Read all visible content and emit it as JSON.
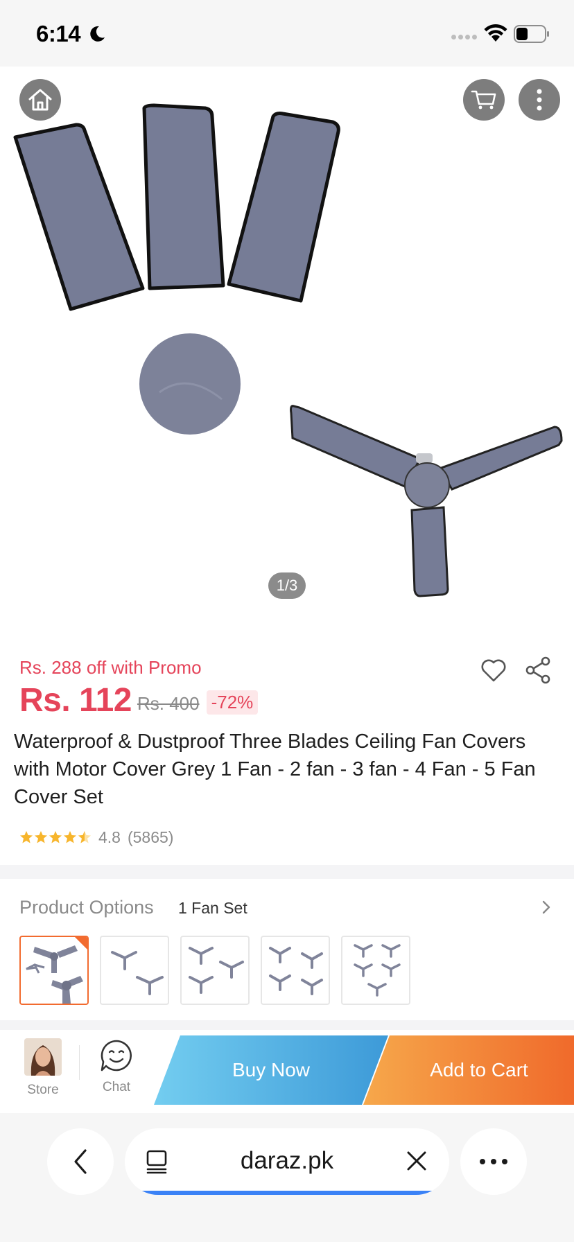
{
  "status_bar": {
    "time": "6:14"
  },
  "gallery": {
    "counter": "1/3",
    "icons": [
      "home-icon",
      "cart-icon",
      "more-vertical-icon"
    ]
  },
  "price": {
    "promo": "Rs. 288 off with Promo",
    "current": "Rs. 112",
    "original": "Rs. 400",
    "discount": "-72%"
  },
  "product": {
    "title": "Waterproof & Dustproof Three Blades Ceiling Fan Covers with Motor Cover Grey 1 Fan - 2 fan - 3 fan - 4 Fan - 5 Fan Cover Set",
    "rating": "4.8",
    "rating_count": "(5865)",
    "stars": 4.8
  },
  "options": {
    "label": "Product Options",
    "selected": "1 Fan Set",
    "thumbnails": [
      1,
      2,
      3,
      4,
      5
    ],
    "selected_index": 0
  },
  "action_bar": {
    "store_label": "Store",
    "chat_label": "Chat",
    "buy_now": "Buy Now",
    "add_to_cart": "Add to Cart"
  },
  "browser": {
    "url": "daraz.pk"
  },
  "colors": {
    "price_red": "#e5445a",
    "accent_orange": "#f26b2f",
    "buy_blue": "#3d9ad8",
    "progress_blue": "#3b82f6"
  }
}
